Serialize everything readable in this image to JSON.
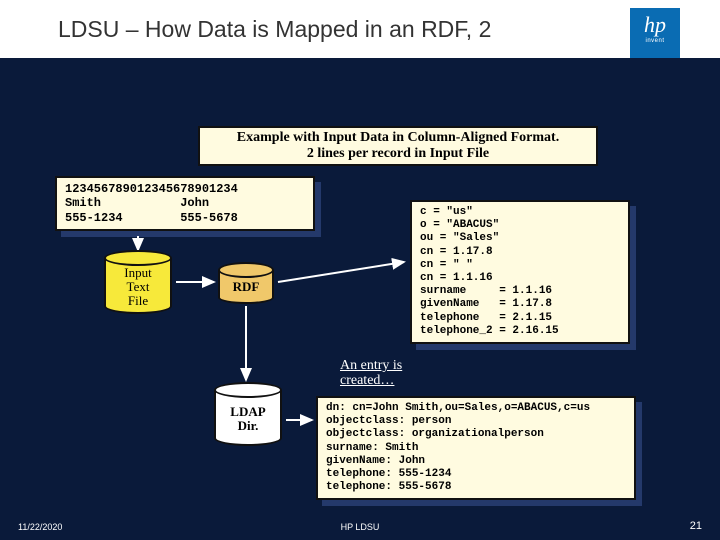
{
  "header": {
    "title": "LDSU – How Data is Mapped in an RDF, 2",
    "logo_text": "hp",
    "logo_sub": "invent"
  },
  "example_box": {
    "line1": "Example with Input Data in Column-Aligned Format.",
    "line2": "2 lines per record in Input File"
  },
  "input_data": "123456789012345678901234\nSmith           John\n555-1234        555-5678",
  "shapes": {
    "input_file": "Input\nText\nFile",
    "rdf": "RDF",
    "ldap": "LDAP\nDir."
  },
  "rdf_output": "c = \"us\"\no = \"ABACUS\"\nou = \"Sales\"\ncn = 1.17.8\ncn = \" \"\ncn = 1.1.16\nsurname     = 1.1.16\ngivenName   = 1.17.8\ntelephone   = 2.1.15\ntelephone_2 = 2.16.15",
  "entry_label": "An entry is\ncreated…",
  "ldap_output": "dn: cn=John Smith,ou=Sales,o=ABACUS,c=us\nobjectclass: person\nobjectclass: organizationalperson\nsurname: Smith\ngivenName: John\ntelephone: 555-1234\ntelephone: 555-5678",
  "footer": {
    "date": "11/22/2020",
    "center": "HP LDSU",
    "page": "21"
  }
}
